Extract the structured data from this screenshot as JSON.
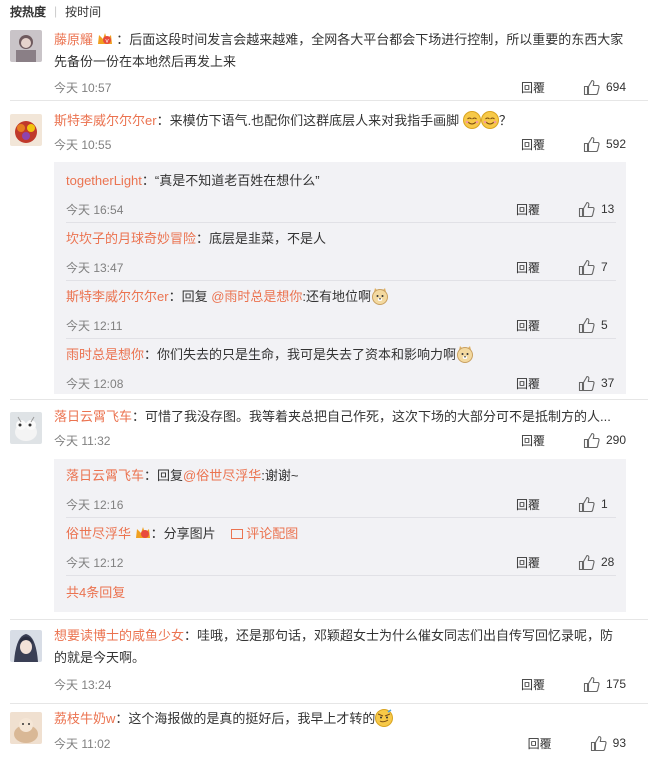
{
  "sort": {
    "hot": "按热度",
    "time": "按时间"
  },
  "reply_label": "回覆",
  "comments": [
    {
      "user": "藤原耀",
      "text": "：后面这段时间发言会越来越难，全网各大平台都会下场进行控制，所以重要的东西大家先备份一份在本地然后再发上来",
      "time": "今天 10:57",
      "likes": "694"
    },
    {
      "user": "斯特李威尔尔尔er",
      "text": "：来模仿下语气.也配你们这群底层人来对我指手画脚",
      "text_end": "？",
      "time": "今天 10:55",
      "likes": "592",
      "replies": [
        {
          "user": "togetherLight",
          "text": "：“真是不知道老百姓在想什么”",
          "time": "今天 16:54",
          "likes": "13"
        },
        {
          "user": "坎坎子的月球奇妙冒险",
          "text": "：底层是韭菜，不是人",
          "time": "今天 13:47",
          "likes": "7"
        },
        {
          "user": "斯特李威尔尔尔er",
          "text_pre": "：回复 ",
          "mention": "@雨时总是想你",
          "text": ":还有地位啊",
          "time": "今天 12:11",
          "likes": "5"
        },
        {
          "user": "雨时总是想你",
          "text": "：你们失去的只是生命，我可是失去了资本和影响力啊",
          "time": "今天 12:08",
          "likes": "37"
        }
      ]
    },
    {
      "user": "落日云霄飞车",
      "text": "：可惜了我没存图。我等着夹总把自己作死，这次下场的大部分可不是抵制方的人...",
      "time": "今天 11:32",
      "likes": "290",
      "replies": [
        {
          "user": "落日云霄飞车",
          "text_pre": "：回复",
          "mention": "@俗世尽浮华",
          "text": ":谢谢~",
          "time": "今天 12:16",
          "likes": "1"
        },
        {
          "user": "俗世尽浮华",
          "text": "：分享图片",
          "pic_link": "评论配图",
          "time": "今天 12:12",
          "likes": "28"
        }
      ],
      "more_replies": "共4条回复"
    },
    {
      "user": "想要读博士的咸鱼少女",
      "text": "：哇哦，还是那句话，邓颖超女士为什么催女同志们出自传写回忆录呢，防的就是今天啊。",
      "time": "今天 13:24",
      "likes": "175"
    },
    {
      "user": "荔枝牛奶w",
      "text": "：这个海报做的是真的挺好后，我早上才转的",
      "time": "今天 11:02",
      "likes": "93"
    }
  ],
  "colors": {
    "link": "#eb7350",
    "subbox": "#f2f2f5",
    "divider": "#e6e6e6",
    "text": "#333333",
    "meta": "#808080"
  }
}
